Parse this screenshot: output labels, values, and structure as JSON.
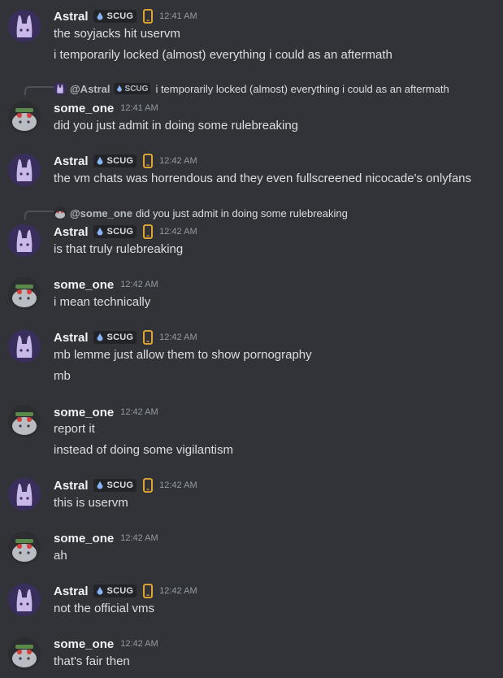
{
  "users": {
    "astral": {
      "name": "Astral",
      "tag": "SCUG"
    },
    "some_one": {
      "name": "some_one"
    }
  },
  "messages": [
    {
      "author": "Astral",
      "tag": "SCUG",
      "time": "12:41 AM",
      "lines": [
        "the soyjacks hit uservm",
        "i temporarily locked (almost) everything i could as an aftermath"
      ]
    },
    {
      "author": "some_one",
      "time": "12:41 AM",
      "reply": {
        "name": "@Astral",
        "tag": "SCUG",
        "text": "i temporarily locked (almost) everything i could as an aftermath"
      },
      "lines": [
        "did you just admit in doing some rulebreaking"
      ]
    },
    {
      "author": "Astral",
      "tag": "SCUG",
      "time": "12:42 AM",
      "lines": [
        "the vm chats was horrendous and they even fullscreened nicocade's onlyfans"
      ]
    },
    {
      "author": "Astral",
      "tag": "SCUG",
      "time": "12:42 AM",
      "reply": {
        "name": "@some_one",
        "text": "did you just admit in doing some rulebreaking"
      },
      "lines": [
        "is that truly rulebreaking"
      ]
    },
    {
      "author": "some_one",
      "time": "12:42 AM",
      "lines": [
        "i mean technically"
      ]
    },
    {
      "author": "Astral",
      "tag": "SCUG",
      "time": "12:42 AM",
      "lines": [
        "mb lemme just allow them to show pornography",
        "mb"
      ]
    },
    {
      "author": "some_one",
      "time": "12:42 AM",
      "lines": [
        "report it",
        "instead of doing some vigilantism"
      ]
    },
    {
      "author": "Astral",
      "tag": "SCUG",
      "time": "12:42 AM",
      "lines": [
        "this is uservm"
      ]
    },
    {
      "author": "some_one",
      "time": "12:42 AM",
      "lines": [
        "ah"
      ]
    },
    {
      "author": "Astral",
      "tag": "SCUG",
      "time": "12:42 AM",
      "lines": [
        "not the official vms"
      ]
    },
    {
      "author": "some_one",
      "time": "12:42 AM",
      "lines": [
        "that's fair then"
      ]
    }
  ],
  "colors": {
    "background": "#313338",
    "name": "#f2f3f5",
    "text": "#dbdee1",
    "muted": "#949ba4",
    "phone_icon": "#f0b232",
    "tag_icon": "#8ab4f8"
  },
  "icons": {
    "tag": "droplet-icon",
    "device": "mobile-phone-icon",
    "astral_avatar": "bunny-avatar",
    "some_one_avatar": "creature-avatar"
  }
}
